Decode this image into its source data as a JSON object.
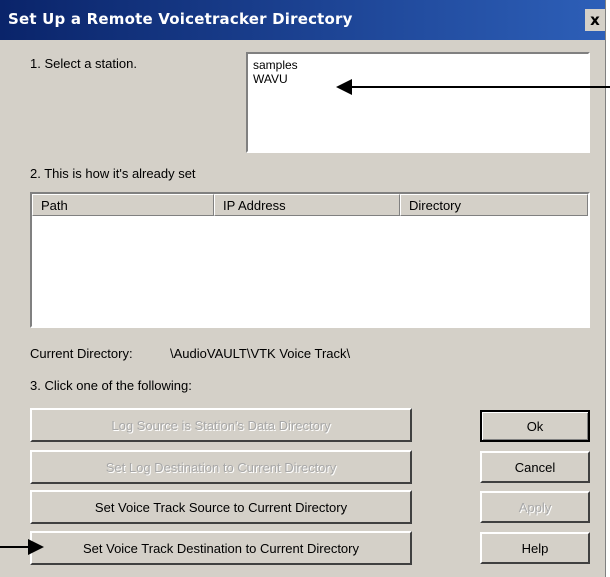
{
  "window": {
    "title": "Set Up a Remote Voicetracker Directory",
    "close_glyph": "x"
  },
  "step1": {
    "label": "1. Select a station.",
    "stations": [
      "samples",
      "WAVU"
    ]
  },
  "step2": {
    "label": "2. This is how it's already set",
    "columns": [
      "Path",
      "IP Address",
      "Directory"
    ],
    "rows": []
  },
  "current_directory": {
    "label": "Current Directory:",
    "value": "\\AudioVAULT\\VTK Voice Track\\"
  },
  "step3": {
    "label": "3. Click one of the following:"
  },
  "action_buttons": {
    "log_source": {
      "label": "Log Source is Station's Data Directory",
      "enabled": false
    },
    "log_destination": {
      "label": "Set Log Destination to Current Directory",
      "enabled": false
    },
    "vt_source": {
      "label": "Set Voice Track Source to Current Directory",
      "enabled": true
    },
    "vt_destination": {
      "label": "Set Voice Track Destination to Current Directory",
      "enabled": true
    }
  },
  "dialog_buttons": {
    "ok": {
      "label": "Ok",
      "enabled": true
    },
    "cancel": {
      "label": "Cancel",
      "enabled": true
    },
    "apply": {
      "label": "Apply",
      "enabled": false
    },
    "help": {
      "label": "Help",
      "enabled": true
    }
  },
  "annotations": {
    "arrow1_icon": "left-arrow-icon",
    "arrow2_icon": "right-arrow-icon"
  }
}
